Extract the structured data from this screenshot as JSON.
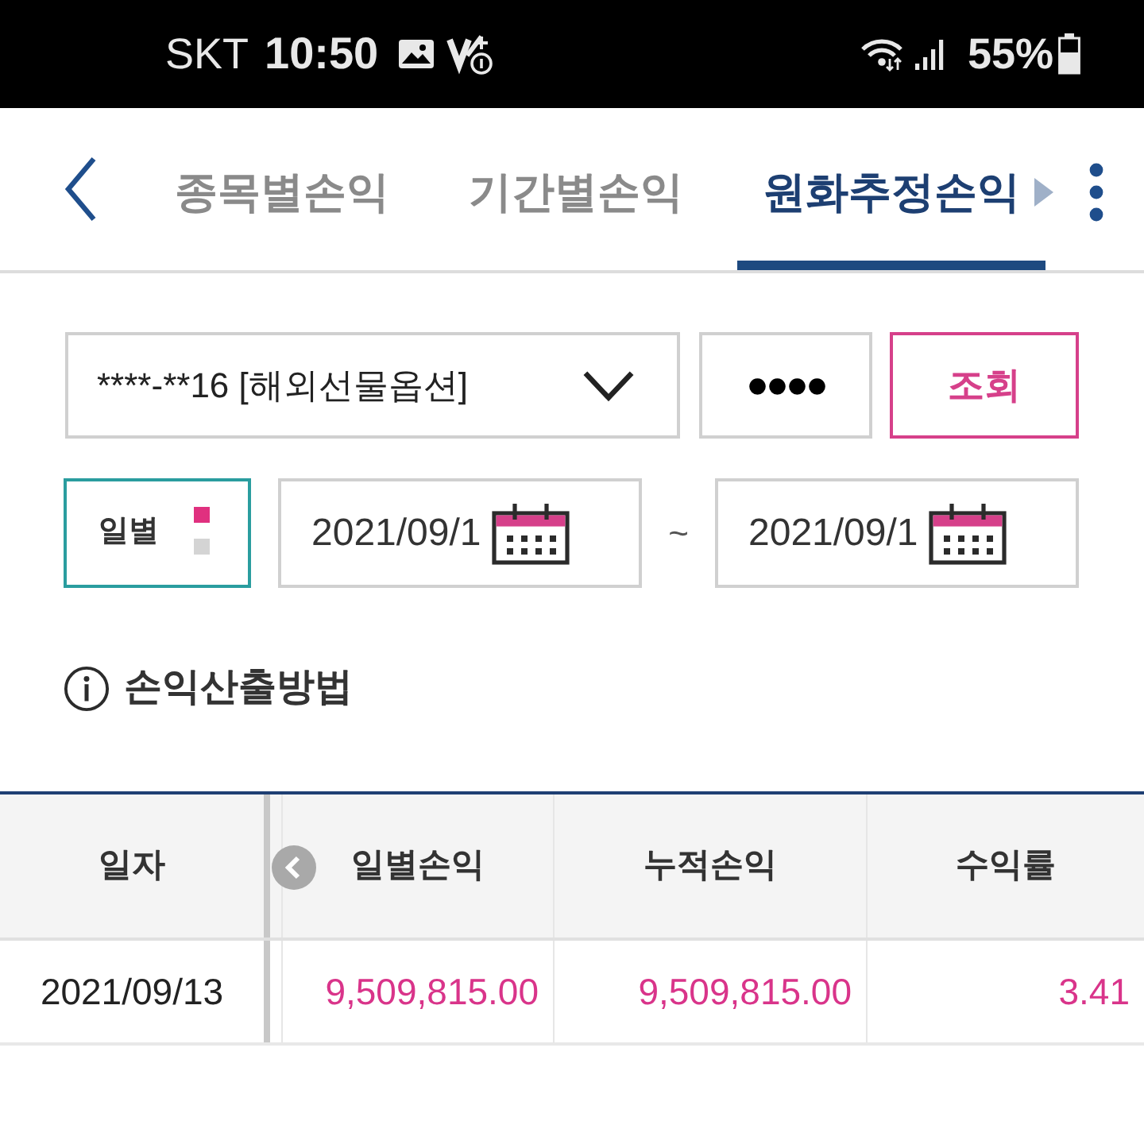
{
  "status_bar": {
    "carrier": "SKT",
    "time": "10:50",
    "battery": "55%"
  },
  "tabs": [
    {
      "label": "종목별손익",
      "selected": false
    },
    {
      "label": "기간별손익",
      "selected": false
    },
    {
      "label": "원화추정손익",
      "selected": true
    }
  ],
  "query": {
    "account": "****-**16 [해외선물옵션]",
    "password": "●●●●",
    "button": "조회"
  },
  "period": {
    "unit": {
      "value": "일별",
      "indicator": [
        {
          "selected": true
        },
        {
          "selected": false
        }
      ]
    },
    "start_date": "2021/09/1",
    "separator": "~",
    "end_date": "2021/09/1"
  },
  "info_link": "손익산출방법",
  "table": {
    "columns": [
      "일자",
      "일별손익",
      "누적손익",
      "수익률"
    ],
    "rows": [
      [
        "2021/09/13",
        "9,509,815.00",
        "9,509,815.00",
        "3.41"
      ]
    ]
  }
}
